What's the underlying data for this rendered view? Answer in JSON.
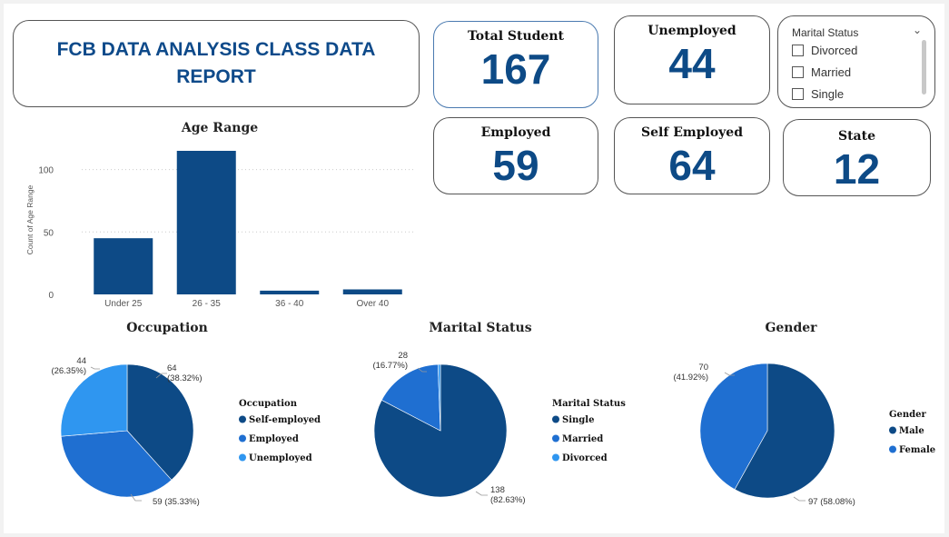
{
  "report": {
    "title": "FCB DATA ANALYSIS CLASS DATA REPORT"
  },
  "kpis": {
    "total_student": {
      "label": "Total Student",
      "value": "167"
    },
    "unemployed": {
      "label": "Unemployed",
      "value": "44"
    },
    "employed": {
      "label": "Employed",
      "value": "59"
    },
    "self_employed": {
      "label": "Self Employed",
      "value": "64"
    },
    "state": {
      "label": "State",
      "value": "12"
    }
  },
  "slicer": {
    "title": "Marital Status",
    "options": [
      "Divorced",
      "Married",
      "Single"
    ]
  },
  "colors": {
    "dark": "#0d4a86",
    "mid": "#1f6fd1",
    "light": "#2f96f0",
    "accent_text": "#0e4a8a"
  },
  "chart_data": [
    {
      "type": "bar",
      "title": "Age Range",
      "xlabel": "",
      "ylabel": "Count of Age Range",
      "categories": [
        "Under 25",
        "26 - 35",
        "36 - 40",
        "Over 40"
      ],
      "values": [
        45,
        115,
        3,
        4
      ],
      "ylim": [
        0,
        125
      ],
      "yticks": [
        0,
        50,
        100
      ],
      "grid": true
    },
    {
      "type": "pie",
      "title": "Occupation",
      "legend_title": "Occupation",
      "labels": [
        "Self-employed",
        "Employed",
        "Unemployed"
      ],
      "values": [
        64,
        59,
        44
      ],
      "percent_labels": [
        "(38.32%)",
        "(35.33%)",
        "(26.35%)"
      ],
      "colors": [
        "#0d4a86",
        "#1f6fd1",
        "#2f96f0"
      ],
      "legend": "right"
    },
    {
      "type": "pie",
      "title": "Marital Status",
      "legend_title": "Marital Status",
      "labels": [
        "Single",
        "Married",
        "Divorced"
      ],
      "values": [
        138,
        28,
        1
      ],
      "percent_labels": [
        "(82.63%)",
        "(16.77%)",
        ""
      ],
      "colors": [
        "#0d4a86",
        "#1f6fd1",
        "#2f96f0"
      ],
      "legend": "right"
    },
    {
      "type": "pie",
      "title": "Gender",
      "legend_title": "Gender",
      "labels": [
        "Male",
        "Female"
      ],
      "values": [
        97,
        70
      ],
      "percent_labels": [
        "(58.08%)",
        "(41.92%)"
      ],
      "colors": [
        "#0d4a86",
        "#1f6fd1"
      ],
      "legend": "right"
    }
  ]
}
